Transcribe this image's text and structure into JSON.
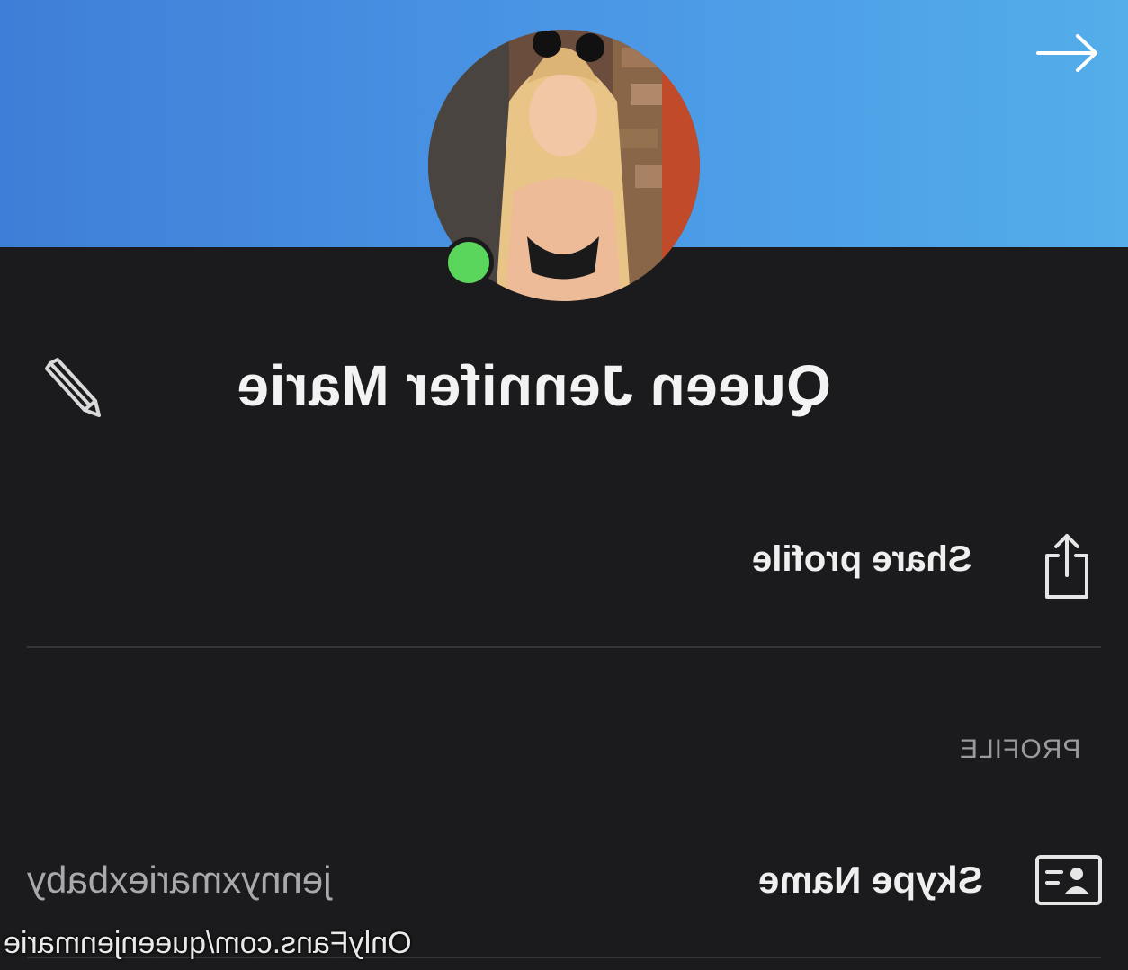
{
  "header": {
    "nav_icon": "arrow-right-icon",
    "banner_gradient": [
      "#3f7ed8",
      "#53aee9"
    ]
  },
  "profile": {
    "display_name": "Queen Jennifer Marie",
    "online_status_color": "#5bd65c",
    "edit_icon": "pencil-icon"
  },
  "actions": {
    "share_label": "Share profile",
    "share_icon": "share-icon"
  },
  "section": {
    "title": "PROFILE"
  },
  "fields": [
    {
      "label": "Skype Name",
      "value": "jennyxmariexbaby",
      "icon": "contact-card-icon"
    }
  ],
  "watermark": {
    "text": "OnlyFans.com/queenjenmarie"
  },
  "theme": {
    "background": "#1b1b1d",
    "text": "#f2f2f2",
    "muted": "#9a9a9f"
  }
}
